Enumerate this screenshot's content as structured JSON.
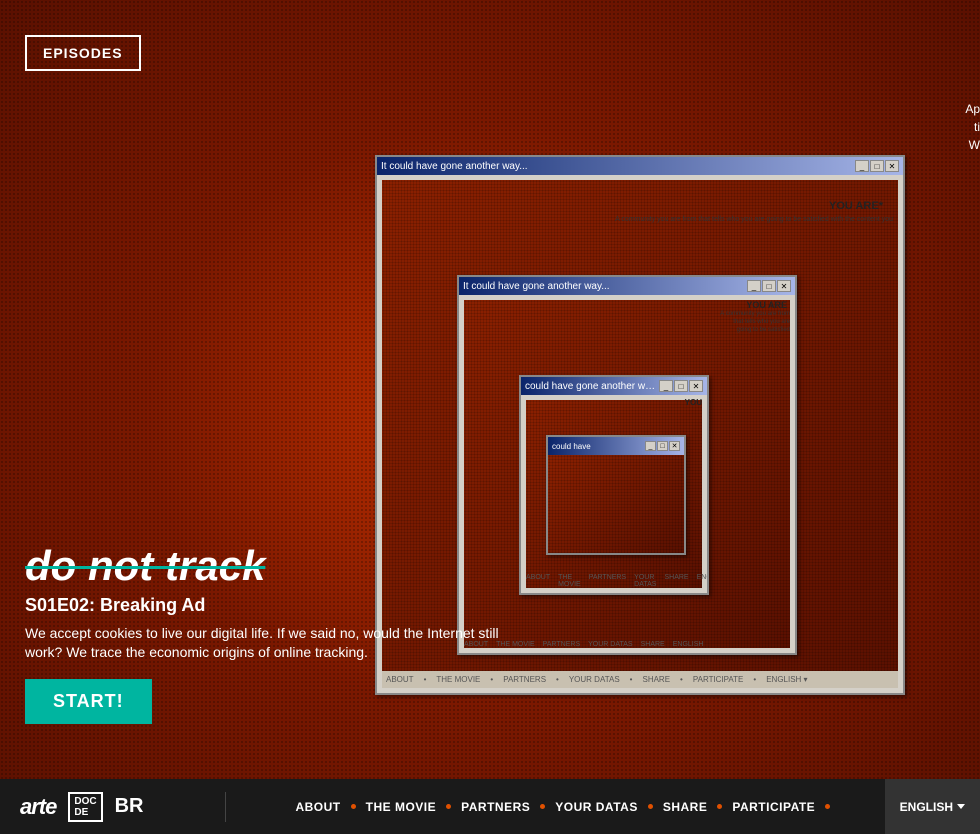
{
  "page": {
    "title": "do not track"
  },
  "episodes_button": {
    "label": "EPISODES"
  },
  "show": {
    "title": "do not track",
    "episode_title": "S01E02: Breaking Ad",
    "description": "We accept cookies to live our digital life. If we said no, would the Internet still work? We trace the economic origins of online tracking.",
    "start_label": "START!"
  },
  "windows": {
    "dialog1": {
      "title": "It could have gone another way...",
      "you_are": "YOU ARE*",
      "text": "A community you are from\nthat tells who you are going\nto be satisfied with\nthe content you"
    },
    "dialog2": {
      "title": "It could have gone another way..."
    },
    "dialog3": {
      "title": "could have gone another way..."
    },
    "dialog4": {
      "title": "could have"
    },
    "nav_items": [
      "ABOUT",
      "THE MOVIE",
      "PARTNERS",
      "YOUR DATAS",
      "SHARE",
      "PARTICIPATE",
      "ENGLISH"
    ]
  },
  "right_side": {
    "text1": "Ap",
    "text2": "ti",
    "text3": "W"
  },
  "bottom_nav": {
    "logos": {
      "arte": "arte",
      "doc": "DOC\nDE",
      "br": "BR"
    },
    "links": [
      {
        "label": "ABOUT"
      },
      {
        "label": "THE MOVIE"
      },
      {
        "label": "PARTNERS"
      },
      {
        "label": "YOUR DATAS"
      },
      {
        "label": "SHARE"
      },
      {
        "label": "PARTICIPATE"
      }
    ],
    "language": "ENGLISH"
  }
}
